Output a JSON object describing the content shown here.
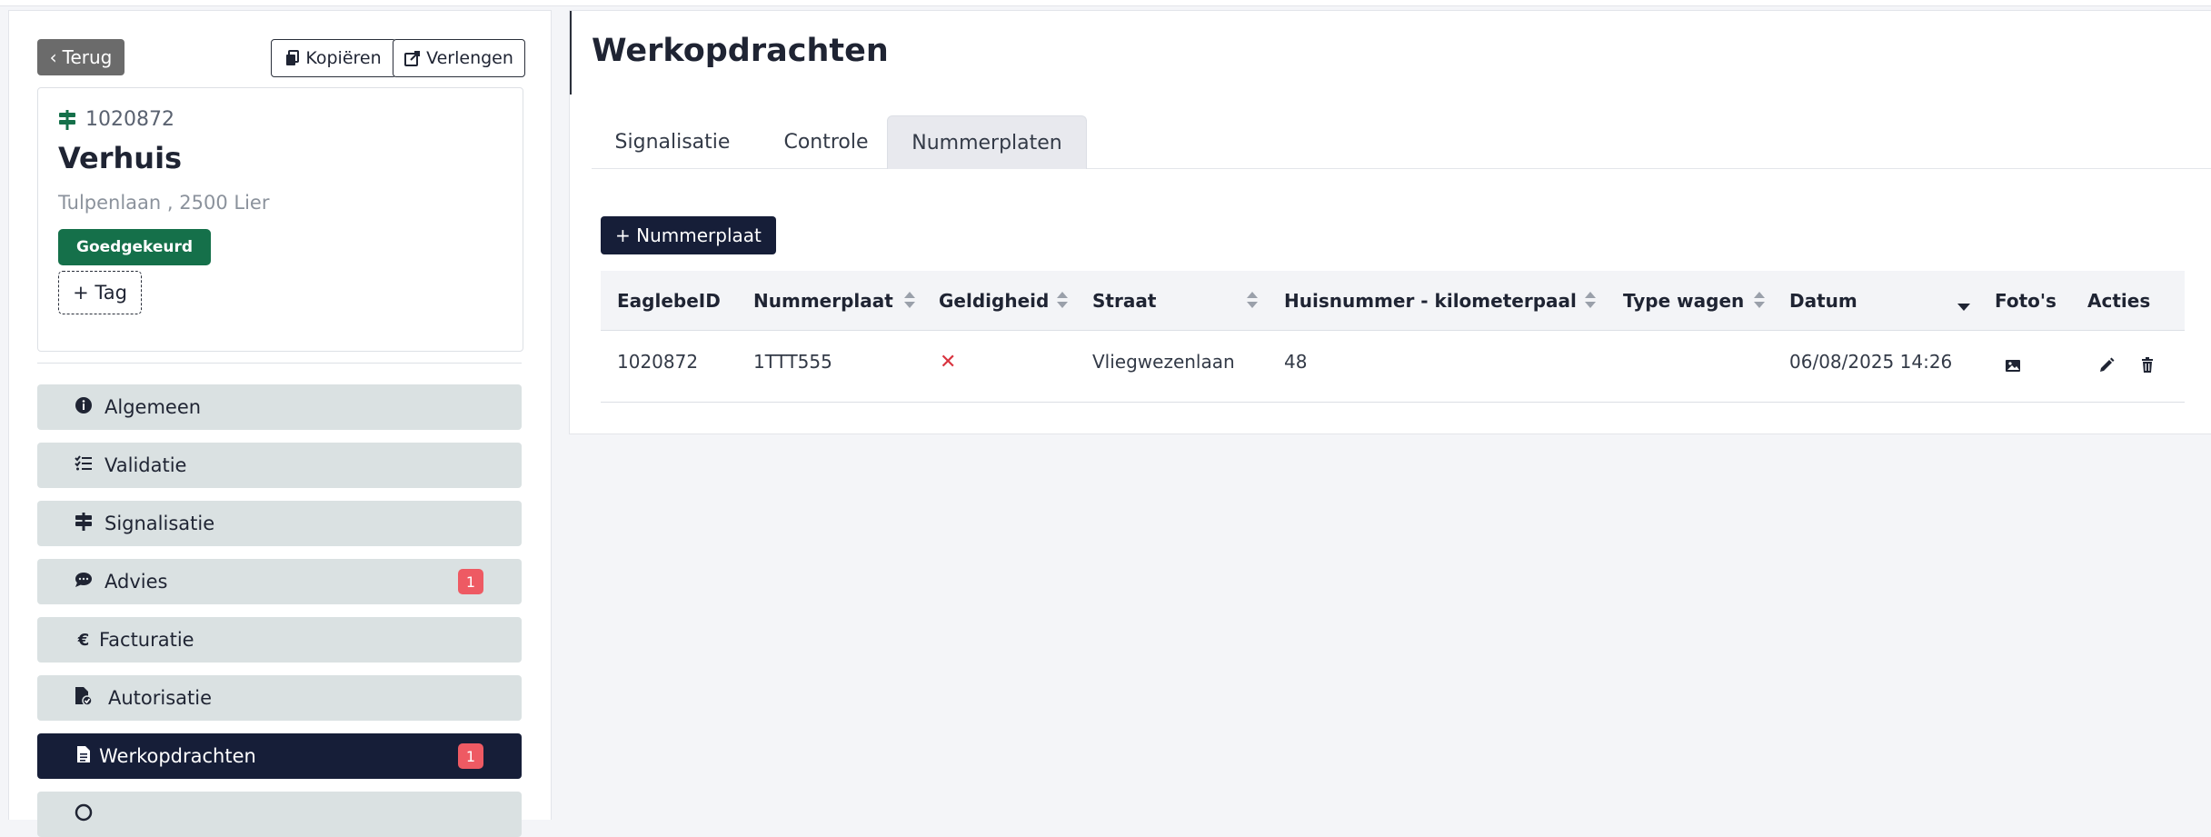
{
  "header": {
    "back_label": "Terug",
    "copy_label": "Kopiëren",
    "extend_label": "Verlengen"
  },
  "project": {
    "id": "1020872",
    "title": "Verhuis",
    "address": "Tulpenlaan , 2500 Lier",
    "status": "Goedgekeurd",
    "add_tag_label": "+ Tag"
  },
  "sidebar": {
    "items": [
      {
        "label": "Algemeen",
        "icon": "info-icon"
      },
      {
        "label": "Validatie",
        "icon": "checklist-icon"
      },
      {
        "label": "Signalisatie",
        "icon": "signpost-icon"
      },
      {
        "label": "Advies",
        "icon": "comments-icon",
        "count": "1"
      },
      {
        "label": "Facturatie",
        "icon": "euro-icon"
      },
      {
        "label": "Autorisatie",
        "icon": "file-check-icon"
      },
      {
        "label": "Werkopdrachten",
        "icon": "file-icon",
        "count": "1",
        "active": true
      }
    ]
  },
  "main": {
    "title": "Werkopdrachten",
    "tabs": [
      {
        "label": "Signalisatie"
      },
      {
        "label": "Controle"
      },
      {
        "label": "Nummerplaten",
        "active": true
      }
    ],
    "add_button_label": "+ Nummerplaat",
    "table": {
      "columns": [
        "EaglebeID",
        "Nummerplaat",
        "Geldigheid",
        "Straat",
        "Huisnummer - kilometerpaal",
        "Type wagen",
        "Datum",
        "Foto's",
        "Acties"
      ],
      "rows": [
        {
          "eaglebe_id": "1020872",
          "nummerplaat": "1TTT555",
          "geldigheid": "✕",
          "straat": "Vliegwezenlaan",
          "huisnummer": "48",
          "type_wagen": "",
          "datum": "06/08/2025 14:26"
        }
      ]
    }
  },
  "colors": {
    "primary_dark": "#161e38",
    "status_green": "#15704a",
    "badge_red": "#ee5a63",
    "nav_bg": "#dae1e2",
    "invalid_red": "#d9343f"
  }
}
